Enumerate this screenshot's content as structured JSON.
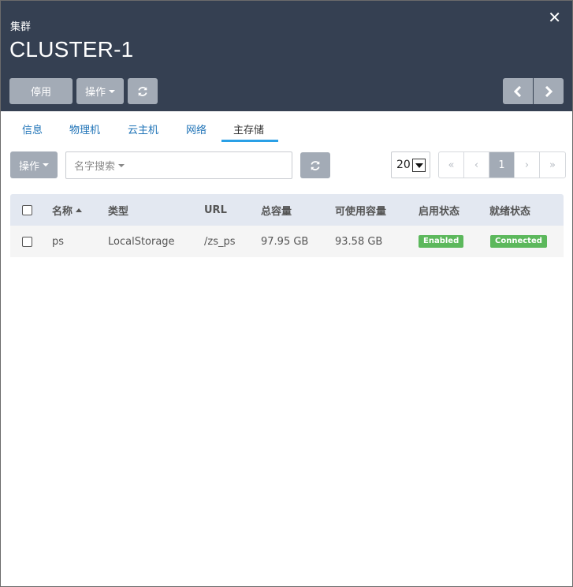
{
  "header": {
    "breadcrumb": "集群",
    "title": "CLUSTER-1",
    "buttons": {
      "disable_label": "停用",
      "ops_label": "操作"
    },
    "close_icon": "close-icon"
  },
  "tabs": [
    {
      "label": "信息"
    },
    {
      "label": "物理机"
    },
    {
      "label": "云主机"
    },
    {
      "label": "网络"
    },
    {
      "label": "主存储"
    }
  ],
  "active_tab": "主存储",
  "toolbar": {
    "ops_label": "操作",
    "search_placeholder": "名字搜索",
    "page_size": "20"
  },
  "pagination": {
    "first": "«",
    "prev": "‹",
    "current": "1",
    "next": "›",
    "last": "»"
  },
  "table": {
    "columns": [
      "名称",
      "类型",
      "URL",
      "总容量",
      "可使用容量",
      "启用状态",
      "就绪状态"
    ],
    "rows": [
      {
        "name": "ps",
        "type": "LocalStorage",
        "url": "/zs_ps",
        "total": "97.95 GB",
        "available": "93.58 GB",
        "state": "Enabled",
        "status": "Connected"
      }
    ]
  },
  "colors": {
    "header_bg": "#354052",
    "button_gray": "#a3abb6",
    "link_blue": "#1f73b7",
    "tab_underline": "#2aa0e6",
    "badge_green": "#5cb85c",
    "table_header_bg": "#e3e8f1"
  }
}
